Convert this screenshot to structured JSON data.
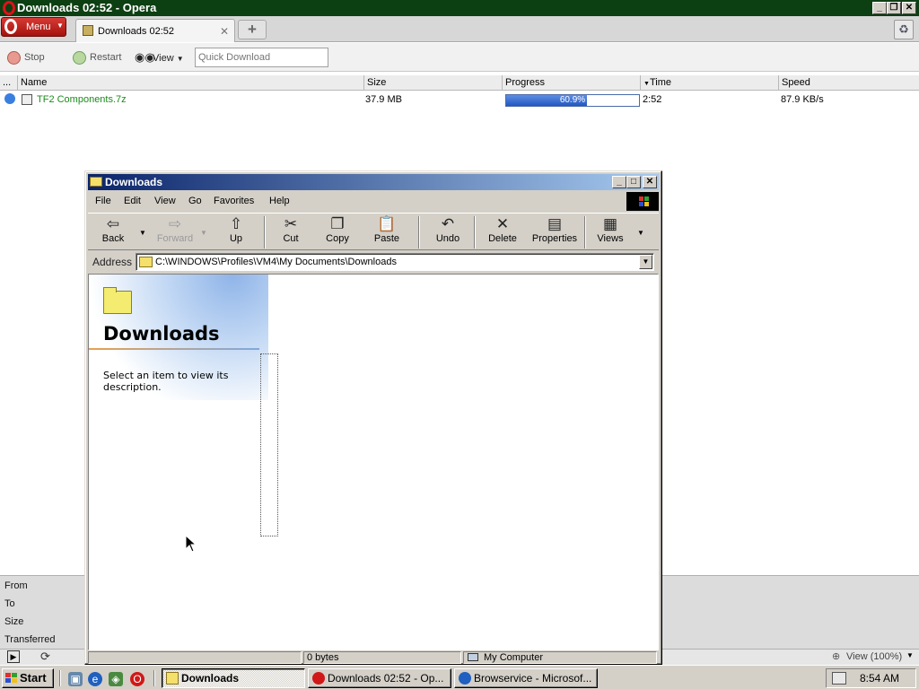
{
  "opera": {
    "title": "Downloads 02:52 - Opera",
    "menu_label": "Menu",
    "tab_label": "Downloads 02:52",
    "toolbar": {
      "stop_label": "Stop",
      "restart_label": "Restart",
      "view_label": "View",
      "quick_download_placeholder": "Quick Download"
    },
    "columns": {
      "more": "...",
      "name": "Name",
      "size": "Size",
      "progress": "Progress",
      "time": "Time",
      "speed": "Speed"
    },
    "download": {
      "name": "TF2 Components.7z",
      "size": "37.9 MB",
      "progress_text": "60.9%",
      "progress_fraction": 0.609,
      "time": "2:52",
      "speed": "87.9 KB/s"
    },
    "details": {
      "from": "From",
      "to": "To",
      "size": "Size",
      "transferred": "Transferred"
    },
    "status": {
      "zoom": "View (100%)"
    }
  },
  "explorer": {
    "title": "Downloads",
    "menu": [
      "File",
      "Edit",
      "View",
      "Go",
      "Favorites",
      "Help"
    ],
    "toolbar": {
      "back": "Back",
      "forward": "Forward",
      "up": "Up",
      "cut": "Cut",
      "copy": "Copy",
      "paste": "Paste",
      "undo": "Undo",
      "delete": "Delete",
      "properties": "Properties",
      "views": "Views"
    },
    "address_label": "Address",
    "address_path": "C:\\WINDOWS\\Profiles\\VM4\\My Documents\\Downloads",
    "folder_heading": "Downloads",
    "description": "Select an item to view its description.",
    "status": {
      "size": "0 bytes",
      "zone": "My Computer"
    }
  },
  "taskbar": {
    "start_label": "Start",
    "tasks": [
      {
        "label": "Downloads"
      },
      {
        "label": "Downloads 02:52 - Op..."
      },
      {
        "label": "Browservice - Microsof..."
      }
    ],
    "clock": "8:54 AM"
  },
  "colors": {
    "opera_title_bg": "#0c3f12",
    "explorer_title_start": "#0a246a",
    "explorer_title_end": "#a6caf0",
    "download_name_color": "#1c8a1c",
    "progress_fill": "#2356c0"
  }
}
